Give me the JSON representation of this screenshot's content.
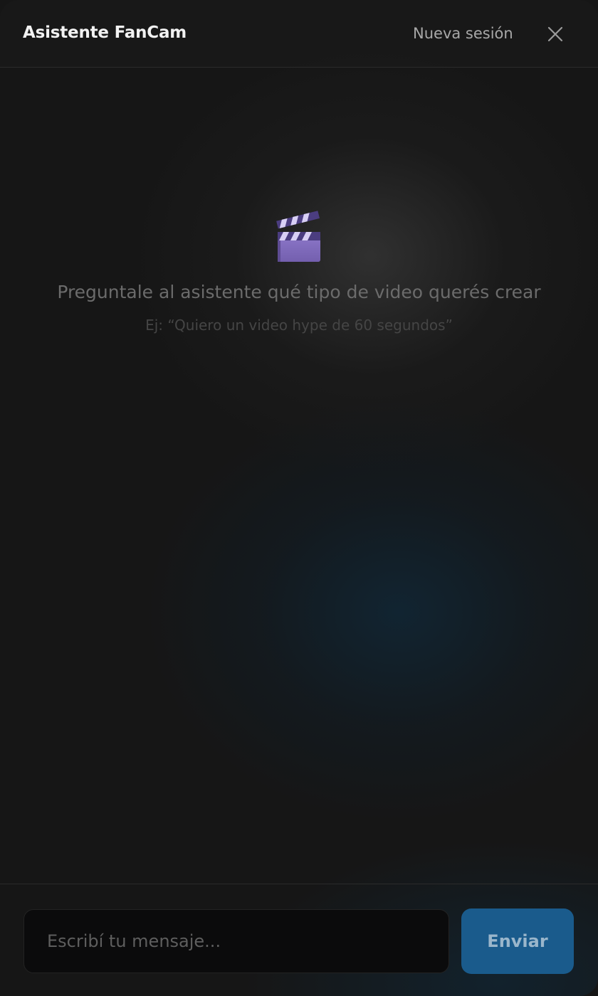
{
  "header": {
    "title": "Asistente FanCam",
    "new_session_label": "Nueva sesión",
    "close_icon": "close-icon"
  },
  "empty_state": {
    "icon": "clapperboard-icon",
    "prompt": "Preguntale al asistente qué tipo de video querés crear",
    "example": "Ej: “Quiero un video hype de 60 segundos”"
  },
  "composer": {
    "placeholder": "Escribí tu mensaje...",
    "value": "",
    "send_label": "Enviar"
  },
  "colors": {
    "background": "#161616",
    "accent": "#1a5b8c",
    "clapper": "#8a72c9"
  }
}
